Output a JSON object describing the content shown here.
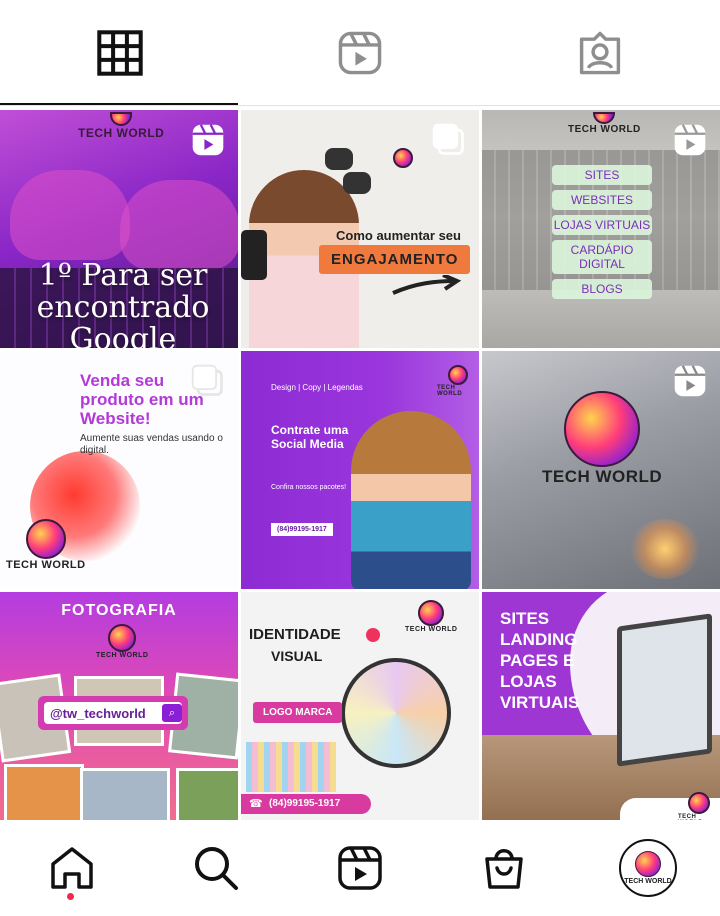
{
  "tabs": [
    {
      "name": "posts",
      "icon": "grid-icon",
      "active": true
    },
    {
      "name": "reels",
      "icon": "reels-icon",
      "active": false
    },
    {
      "name": "tagged",
      "icon": "tagged-icon",
      "active": false
    }
  ],
  "posts": [
    {
      "type": "reel",
      "brand": "TECH WORLD",
      "headline": "1º Para ser encontrado Google"
    },
    {
      "type": "carousel",
      "line1": "Como aumentar seu",
      "highlight": "ENGAJAMENTO"
    },
    {
      "type": "reel",
      "brand": "TECH WORLD",
      "items": [
        "SITES",
        "WEBSITES",
        "LOJAS VIRTUAIS",
        "CARDÁPIO DIGITAL",
        "BLOGS"
      ]
    },
    {
      "type": "carousel",
      "title": "Venda seu produto em um Website!",
      "subtitle": "Aumente suas vendas usando o digital.",
      "brand": "TECH WORLD"
    },
    {
      "type": "image",
      "tags": "Design | Copy | Legendas",
      "title": "Contrate uma Social Media",
      "subtitle": "Confira nossos pacotes!",
      "phone": "(84)99195-1917",
      "brand": "TECH WORLD"
    },
    {
      "type": "reel",
      "brand": "TECH WORLD"
    },
    {
      "type": "image",
      "title": "FOTOGRAFIA",
      "brand": "TECH WORLD",
      "handle": "@tw_techworld"
    },
    {
      "type": "image",
      "title": "IDENTIDADE",
      "title2": "VISUAL",
      "button": "LOGO MARCA",
      "phone": "(84)99195-1917",
      "brand": "TECH WORLD"
    },
    {
      "type": "image",
      "title": "SITES LANDING PAGES E LOJAS VIRTUAIS",
      "brand": "TECH WORLD"
    }
  ],
  "bottom_nav": [
    {
      "name": "home",
      "icon": "home-icon",
      "notification_dot": true
    },
    {
      "name": "search",
      "icon": "search-icon"
    },
    {
      "name": "reels",
      "icon": "reels-icon"
    },
    {
      "name": "shop",
      "icon": "shop-icon"
    },
    {
      "name": "profile",
      "icon": "avatar",
      "label": "TECH WORLD"
    }
  ],
  "colors": {
    "accent_purple": "#8a26c7",
    "pink": "#d93aa0",
    "notification": "#f02849",
    "icon": "#111111",
    "icon_inactive": "#8e8e8e"
  }
}
